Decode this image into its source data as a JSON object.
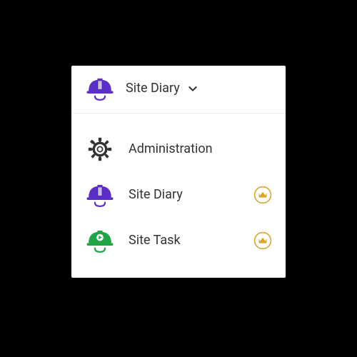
{
  "header": {
    "title": "Site Diary"
  },
  "menu": {
    "items": [
      {
        "label": "Administration"
      },
      {
        "label": "Site Diary"
      },
      {
        "label": "Site Task"
      }
    ]
  },
  "colors": {
    "purple": "#5a2fc9",
    "green": "#1fa446",
    "gold": "#d9a62e",
    "text": "#333333"
  }
}
